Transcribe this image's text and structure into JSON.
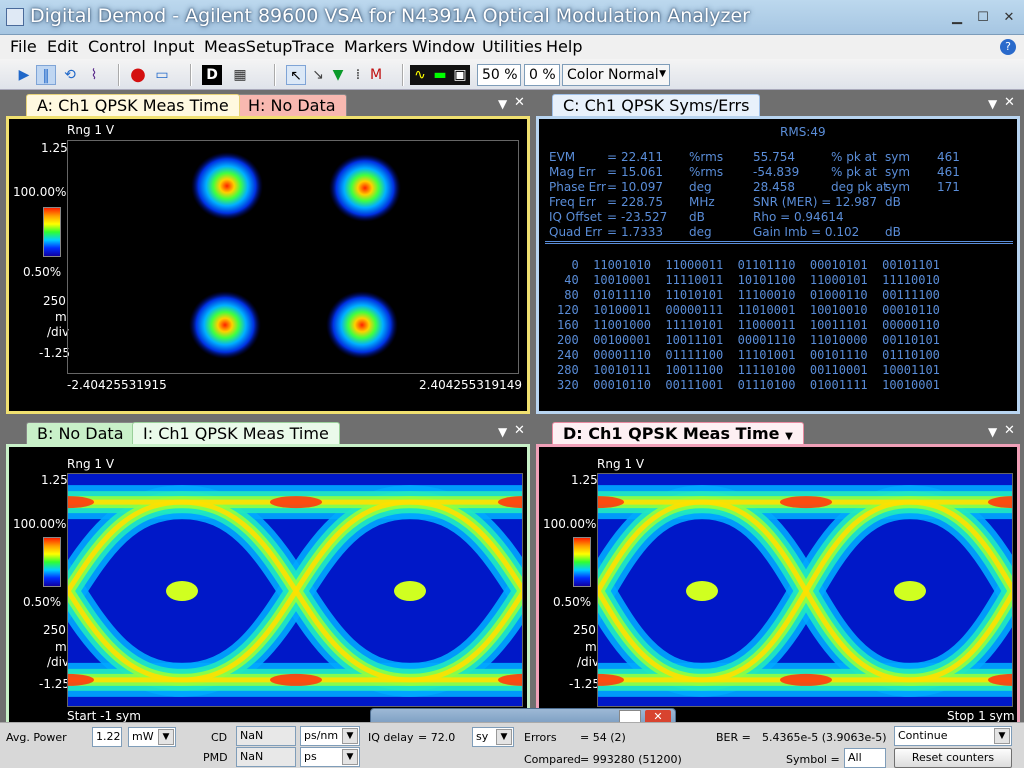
{
  "window": {
    "title": "Digital Demod - Agilent 89600 VSA for N4391A Optical Modulation Analyzer"
  },
  "menu": [
    "File",
    "Edit",
    "Control",
    "Input",
    "MeasSetup",
    "Trace",
    "Markers",
    "Window",
    "Utilities",
    "Help"
  ],
  "toolbar": {
    "zoom1": "50 %",
    "zoom2": "0 %",
    "color_mode": "Color Normal"
  },
  "panels": {
    "A": {
      "tab_active": "A: Ch1 QPSK Meas Time",
      "tab_other": "H: No Data",
      "range": "Rng 1  V",
      "y_top": "1.25",
      "y_bottom": "-1.25",
      "cb_top": "100.00%",
      "cb_bottom": "0.50%",
      "scale_val": "250",
      "scale_unit": "m",
      "scale_div": "/div",
      "x_left": "-2.40425531915",
      "x_right": "2.404255319149"
    },
    "C": {
      "tab_active": "C: Ch1 QPSK Syms/Errs",
      "rms": "RMS:49",
      "rows": [
        {
          "label": "EVM",
          "eq": "=",
          "val": "22.411",
          "unit": "%rms",
          "val2": "55.754",
          "unit2": "% pk  at",
          "sym": "sym",
          "idx": "461"
        },
        {
          "label": "Mag Err",
          "eq": "=",
          "val": "15.061",
          "unit": "%rms",
          "val2": "-54.839",
          "unit2": "% pk  at",
          "sym": "sym",
          "idx": "461"
        },
        {
          "label": "Phase Err",
          "eq": "=",
          "val": "10.097",
          "unit": "deg",
          "val2": "28.458",
          "unit2": "deg  pk  at",
          "sym": "sym",
          "idx": "171"
        },
        {
          "label": "Freq Err",
          "eq": "=",
          "val": "228.75",
          "unit": "MHz",
          "val2": "SNR (MER)  =  12.987",
          "unit2": "",
          "sym": "dB",
          "idx": ""
        },
        {
          "label": "IQ Offset",
          "eq": "=",
          "val": "-23.527",
          "unit": "dB",
          "val2": "Rho         =  0.94614",
          "unit2": "",
          "sym": "",
          "idx": ""
        },
        {
          "label": "Quad Err",
          "eq": "=",
          "val": "1.7333",
          "unit": "deg",
          "val2": "Gain  Imb   =  0.102",
          "unit2": "",
          "sym": "dB",
          "idx": ""
        }
      ],
      "bits": [
        "  0  11001010  11000011  01101110  00010101  00101101",
        " 40  10010001  11110011  10101100  11000101  11110010",
        " 80  01011110  11010101  11100010  01000110  00111100",
        "120  10100011  00000111  11010001  10010010  00010110",
        "160  11001000  11110101  11000011  10011101  00000110",
        "200  00100001  10011101  00001110  11010000  00110101",
        "240  00001110  01111100  11101001  00101110  01110100",
        "280  10010111  10011100  11110100  00110001  10001101",
        "320  00010110  00111001  01110100  01001111  10010001"
      ]
    },
    "B": {
      "tab_inactive": "B: No Data",
      "tab_active": "I: Ch1 QPSK Meas Time",
      "range": "Rng 1  V",
      "y_top": "1.25",
      "y_bottom": "-1.25",
      "cb_top": "100.00%",
      "cb_bottom": "0.50%",
      "scale_val": "250",
      "scale_unit": "m",
      "scale_div": "/div",
      "x_left": "Start -1  sym"
    },
    "D": {
      "tab_active": "D: Ch1 QPSK Meas Time",
      "range": "Rng 1  V",
      "y_top": "1.25",
      "y_bottom": "-1.25",
      "cb_top": "100.00%",
      "cb_bottom": "0.50%",
      "scale_val": "250",
      "scale_unit": "m",
      "scale_div": "/div",
      "x_right": "Stop 1  sym"
    }
  },
  "status": {
    "avg_power_label": "Avg. Power",
    "avg_power_val": "1.22",
    "avg_power_unit": "mW",
    "cd_label": "CD",
    "cd_val": "NaN",
    "cd_unit": "ps/nm",
    "pmd_label": "PMD",
    "pmd_val": "NaN",
    "pmd_unit": "ps",
    "iq_delay_label": "IQ delay",
    "iq_delay_val": "=  72.0",
    "iq_delay_unit": "sy",
    "errors_label": "Errors",
    "errors_val": "=  54 (2)",
    "compared_label": "Compared",
    "compared_val": "=  993280 (51200)",
    "ber_label": "BER =",
    "ber_val": "5.4365e-5 (3.9063e-5)",
    "symbol_label": "Symbol =",
    "symbol_val": "All",
    "mode": "Continue",
    "reset_btn": "Reset counters"
  }
}
